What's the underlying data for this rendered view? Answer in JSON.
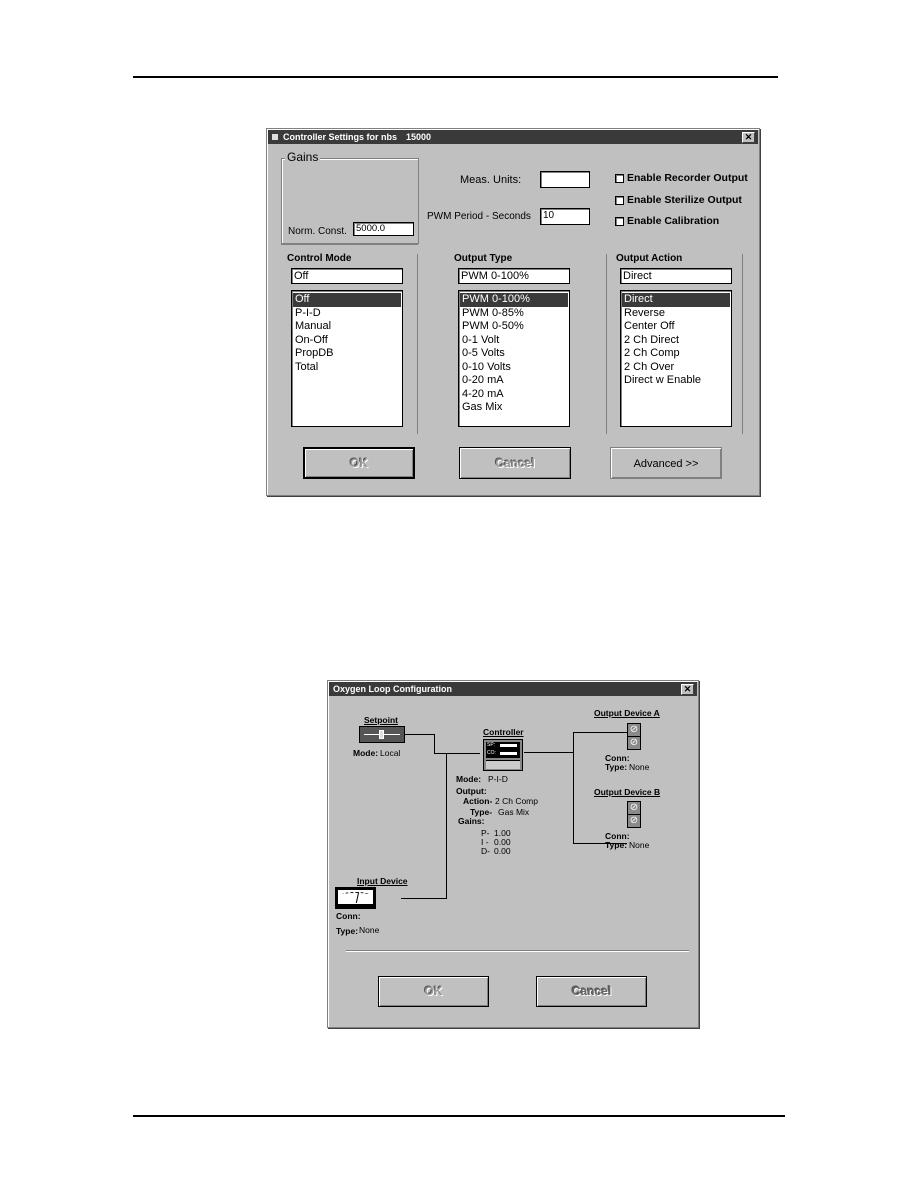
{
  "dialog1": {
    "title": "Controller Settings for nbs",
    "title_id": "15000",
    "close_label": "✕",
    "gains_group_label": "Gains",
    "norm_const_label": "Norm. Const.",
    "norm_const_value": "5000.0",
    "meas_units_label": "Meas. Units:",
    "meas_units_value": "",
    "pwm_period_label": "PWM Period - Seconds",
    "pwm_period_value": "10",
    "checkboxes": [
      {
        "label": "Enable Recorder Output",
        "checked": false
      },
      {
        "label": "Enable Sterilize Output",
        "checked": false
      },
      {
        "label": "Enable Calibration",
        "checked": false
      }
    ],
    "control_mode": {
      "label": "Control Mode",
      "value": "Off",
      "options": [
        "Off",
        "P-I-D",
        "Manual",
        "On-Off",
        "PropDB",
        "Total"
      ],
      "selected": "Off"
    },
    "output_type": {
      "label": "Output Type",
      "value": "PWM 0-100%",
      "options": [
        "PWM 0-100%",
        "PWM 0-85%",
        "PWM 0-50%",
        "0-1 Volt",
        "0-5 Volts",
        "0-10 Volts",
        "0-20 mA",
        "4-20 mA",
        "Gas Mix"
      ],
      "selected": "PWM 0-100%"
    },
    "output_action": {
      "label": "Output Action",
      "value": "Direct",
      "options": [
        "Direct",
        "Reverse",
        "Center Off",
        "2 Ch Direct",
        "2 Ch Comp",
        "2 Ch Over",
        "Direct w Enable"
      ],
      "selected": "Direct"
    },
    "buttons": {
      "ok": "OK",
      "cancel": "Cancel",
      "advanced": "Advanced >>"
    }
  },
  "dialog2": {
    "title": "Oxygen Loop Configuration",
    "close_label": "✕",
    "setpoint": {
      "title": "Setpoint",
      "mode_label": "Mode:",
      "mode_value": "Local"
    },
    "controller": {
      "title": "Controller",
      "display_sp": "SP:",
      "display_co": "CO:",
      "mode_label": "Mode:",
      "mode_value": "P-I-D",
      "output_label": "Output:",
      "action_label": "Action-",
      "action_value": "2 Ch Comp",
      "type_label": "Type-",
      "type_value": "Gas Mix",
      "gains_label": "Gains:",
      "p_label": "P-",
      "p_value": "1.00",
      "i_label": "I -",
      "i_value": "0.00",
      "d_label": "D-",
      "d_value": "0.00"
    },
    "output_device_a": {
      "title": "Output Device A",
      "conn_label": "Conn:",
      "conn_value": "",
      "type_label": "Type:",
      "type_value": "None"
    },
    "output_device_b": {
      "title": "Output Device B",
      "conn_label": "Conn:",
      "conn_value": "",
      "type_label": "Type:",
      "type_value": "None"
    },
    "input_device": {
      "title": "Input Device",
      "conn_label": "Conn:",
      "conn_value": "",
      "type_label": "Type:",
      "type_value": "None"
    },
    "buttons": {
      "ok": "OK",
      "cancel": "Cancel"
    }
  },
  "icons": {
    "device_slot": "⊘"
  }
}
